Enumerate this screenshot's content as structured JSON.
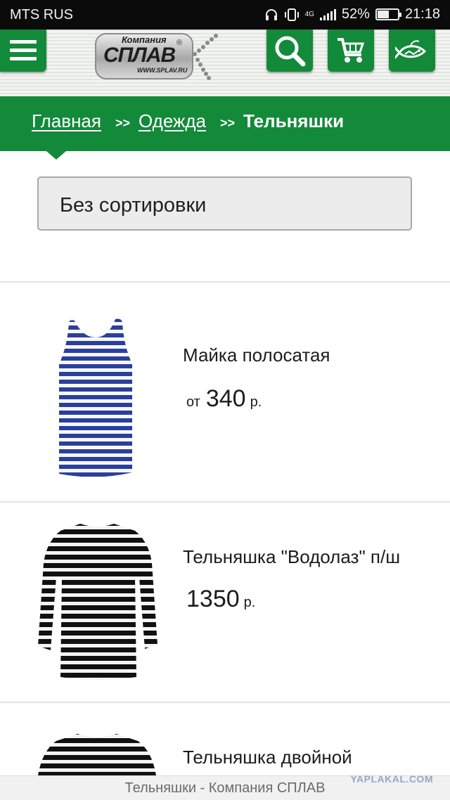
{
  "status_bar": {
    "carrier": "MTS RUS",
    "network": "4G",
    "battery": "52%",
    "battery_level": 0.52,
    "time": "21:18"
  },
  "header": {
    "logo": {
      "small_text": "Компания",
      "big_text": "СПЛАВ",
      "url_text": "WWW.SPLAV.RU",
      "reg_mark": "®"
    },
    "icons": [
      "menu-icon",
      "search-icon",
      "cart-icon",
      "fish-icon"
    ]
  },
  "breadcrumb": {
    "items": [
      {
        "label": "Главная"
      },
      {
        "label": "Одежда"
      }
    ],
    "separator": ">>",
    "current": "Тельняшки"
  },
  "sort": {
    "selected": "Без сортировки"
  },
  "products": [
    {
      "name": "Майка полосатая",
      "price_prefix": "от",
      "price": "340",
      "currency": "р."
    },
    {
      "name": "Тельняшка \"Водолаз\" п/ш",
      "price_prefix": "",
      "price": "1350",
      "currency": "р."
    },
    {
      "name": "Тельняшка двойной",
      "price_prefix": "",
      "price": "",
      "currency": ""
    }
  ],
  "colors": {
    "brand_green": "#138a3a",
    "tank_stripe": "#2b3f9c",
    "shirt_stripe": "#111111"
  },
  "bottom_bar": {
    "page_title": "Тельняшки - Компания СПЛАВ",
    "watermark": "YAPLAKAL.COM"
  }
}
